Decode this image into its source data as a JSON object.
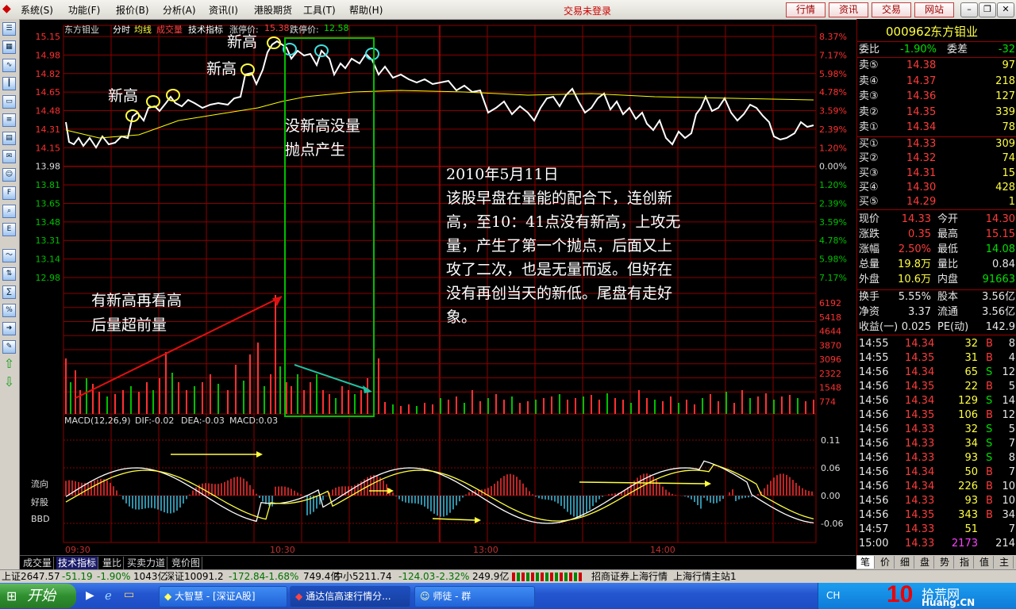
{
  "menubar": {
    "items": [
      "系统(S)",
      "功能(F)",
      "报价(B)",
      "分析(A)",
      "资讯(I)",
      "港股期货",
      "工具(T)",
      "帮助(H)"
    ],
    "status": "交易未登录",
    "buttons": [
      "行情",
      "资讯",
      "交易",
      "网站"
    ]
  },
  "chart": {
    "header": {
      "name": "东方钼业",
      "mode": "分时",
      "avg": "均线",
      "vol": "成交量",
      "tech": "技术指标",
      "up_limit_label": "涨停价:",
      "up_limit": "15.38",
      "down_limit_label": "跌停价:",
      "down_limit": "12.58"
    },
    "price_ticks": [
      "15.15",
      "14.98",
      "14.82",
      "14.65",
      "14.48",
      "14.31",
      "14.15",
      "13.98",
      "13.81",
      "13.65",
      "13.48",
      "13.31",
      "13.14",
      "12.98"
    ],
    "pct_ticks": [
      "8.37%",
      "7.17%",
      "5.98%",
      "4.78%",
      "3.59%",
      "2.39%",
      "1.20%",
      "0.00%",
      "1.20%",
      "2.39%",
      "3.59%",
      "4.78%",
      "5.98%",
      "7.17%"
    ],
    "vol_ticks": [
      "6192",
      "5418",
      "4644",
      "3870",
      "3096",
      "2322",
      "1548",
      "774"
    ],
    "macd_ticks": [
      "0.11",
      "0.06",
      "0.00",
      "-0.06"
    ],
    "macd_header": {
      "title": "MACD(12,26,9)",
      "dif": "DIF:-0.02",
      "dea": "DEA:-0.03",
      "macd": "MACD:0.03"
    },
    "left_labels": [
      "流向",
      "好股",
      "BBD"
    ],
    "time_ticks": [
      "09:30",
      "10:30",
      "13:00",
      "14:00"
    ],
    "annotations": {
      "xingao1": "新高",
      "xingao2": "新高",
      "xingao3": "新高",
      "box_line1": "没新高没量",
      "box_line2": "抛点产生",
      "left_line1": "有新高再看高",
      "left_line2": "后量超前量",
      "text_lines": [
        "2010年5月11日",
        "该股早盘在量能的配合下，连创新",
        "高，至10：41点没有新高，上攻无",
        "量，产生了第一个抛点，后面又上",
        "攻了二次，也是无量而返。但好在",
        "没有再创当天的新低。尾盘有走好",
        "象。"
      ]
    },
    "colors": {
      "price": "#ffffff",
      "avg": "#ffff00",
      "grid": "#8b0000",
      "up": "#ff3030",
      "down": "#00c000",
      "macd_neg": "#40c0e0",
      "box": "#00c000"
    }
  },
  "quote": {
    "code": "000962",
    "name": "东方钼业",
    "weibi_label": "委比",
    "weibi": "-1.90%",
    "weicha_label": "委差",
    "weicha": "-32",
    "asks": [
      [
        "卖⑤",
        "14.38",
        "97"
      ],
      [
        "卖④",
        "14.37",
        "218"
      ],
      [
        "卖③",
        "14.36",
        "127"
      ],
      [
        "卖②",
        "14.35",
        "339"
      ],
      [
        "卖①",
        "14.34",
        "78"
      ]
    ],
    "bids": [
      [
        "买①",
        "14.33",
        "309"
      ],
      [
        "买②",
        "14.32",
        "74"
      ],
      [
        "买③",
        "14.31",
        "15"
      ],
      [
        "买④",
        "14.30",
        "428"
      ],
      [
        "买⑤",
        "14.29",
        "1"
      ]
    ],
    "stats": [
      [
        "现价",
        "14.33",
        "今开",
        "14.30"
      ],
      [
        "涨跌",
        "0.35",
        "最高",
        "15.15"
      ],
      [
        "涨幅",
        "2.50%",
        "最低",
        "14.08"
      ],
      [
        "总量",
        "19.8万",
        "量比",
        "0.84"
      ],
      [
        "外盘",
        "10.6万",
        "内盘",
        "91663"
      ]
    ],
    "stats2": [
      [
        "换手",
        "5.55%",
        "股本",
        "3.56亿"
      ],
      [
        "净资",
        "3.37",
        "流通",
        "3.56亿"
      ],
      [
        "收益(一)",
        "0.025",
        "PE(动)",
        "142.9"
      ]
    ],
    "ticks": [
      [
        "14:55",
        "14.34",
        "32",
        "B",
        "8"
      ],
      [
        "14:55",
        "14.35",
        "31",
        "B",
        "4"
      ],
      [
        "14:56",
        "14.34",
        "65",
        "S",
        "12"
      ],
      [
        "14:56",
        "14.35",
        "22",
        "B",
        "5"
      ],
      [
        "14:56",
        "14.34",
        "129",
        "S",
        "14"
      ],
      [
        "14:56",
        "14.35",
        "106",
        "B",
        "12"
      ],
      [
        "14:56",
        "14.33",
        "32",
        "S",
        "5"
      ],
      [
        "14:56",
        "14.33",
        "34",
        "S",
        "7"
      ],
      [
        "14:56",
        "14.33",
        "93",
        "S",
        "8"
      ],
      [
        "14:56",
        "14.34",
        "50",
        "B",
        "7"
      ],
      [
        "14:56",
        "14.34",
        "226",
        "B",
        "10"
      ],
      [
        "14:56",
        "14.33",
        "93",
        "B",
        "10"
      ],
      [
        "14:56",
        "14.35",
        "343",
        "B",
        "34"
      ],
      [
        "14:57",
        "14.33",
        "51",
        "",
        "7"
      ],
      [
        "15:00",
        "14.33",
        "2173",
        "",
        "214"
      ]
    ]
  },
  "bottom_tabs": [
    "成交量",
    "技术指标",
    "量比",
    "买卖力道",
    "竞价图"
  ],
  "right_tabs": [
    "笔",
    "价",
    "细",
    "盘",
    "势",
    "指",
    "值",
    "主"
  ],
  "statusbar": {
    "sh": "上证2647.57",
    "sh_chg": "-51.19",
    "sh_pct": "-1.90%",
    "sh_amt": "1043亿",
    "sz": "深证10091.2",
    "sz_chg": "-172.84",
    "sz_pct": "-1.68%",
    "sz_amt": "749.4亿",
    "zx": "中小5211.74",
    "zx_chg": "-124.03",
    "zx_pct": "-2.32%",
    "zx_amt": "249.9亿",
    "broker": "招商证券上海行情",
    "site": "上海行情主站1"
  },
  "taskbar": {
    "start": "开始",
    "tasks": [
      "大智慧 - [深证A股]",
      "通达信高速行情分...",
      "师徒 - 群"
    ],
    "tray_lang": "CH",
    "logo": "拾荒网",
    "logo_sub": "Huang.CN"
  }
}
